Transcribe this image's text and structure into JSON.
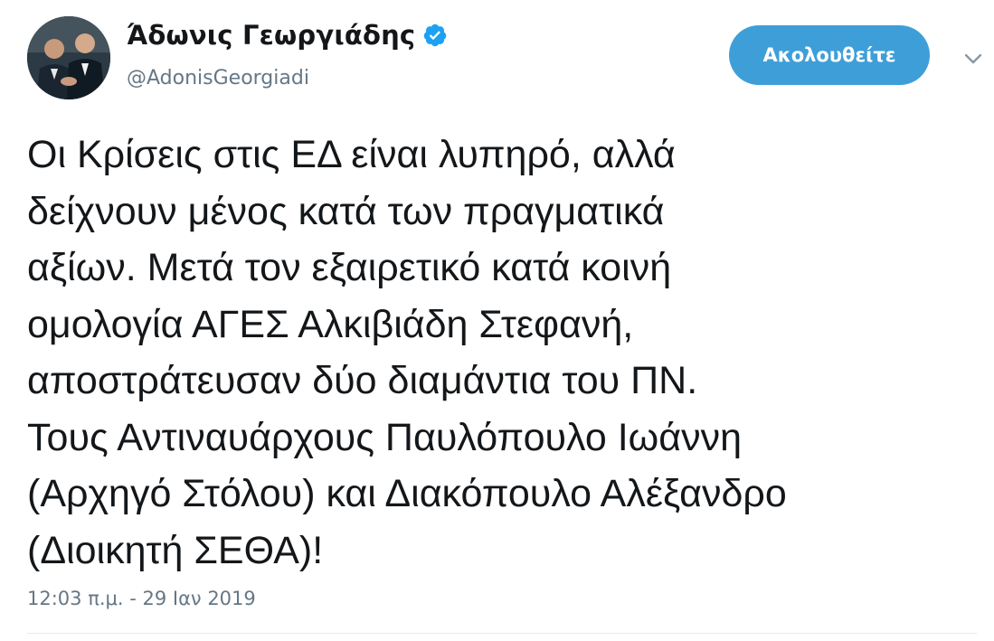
{
  "author": {
    "display_name": "Άδωνις Γεωργιάδης",
    "handle": "@AdonisGeorgiadi",
    "verified": true,
    "avatar_icon": "profile-photo"
  },
  "actions": {
    "follow_label": "Ακολουθείτε",
    "menu_icon": "chevron-down-icon"
  },
  "tweet": {
    "lines": [
      "Οι Κρίσεις στις ΕΔ είναι λυπηρό, αλλά",
      "δείχνουν μένος κατά των πραγματικά",
      "αξίων. Μετά τον εξαιρετικό κατά κοινή",
      "ομολογία ΑΓΕΣ Αλκιβιάδη Στεφανή,",
      "αποστράτευσαν δύο διαμάντια του ΠΝ.",
      "Τους Αντιναυάρχους Παυλόπουλο Ιωάννη",
      "(Αρχηγό Στόλου) και Διακόπουλο Αλέξανδρο",
      "(Διοικητή ΣΕΘΑ)!"
    ],
    "timestamp": "12:03 π.μ. - 29 Ιαν 2019"
  },
  "colors": {
    "accent": "#3e9fd8",
    "verified_badge": "#1da1f2",
    "secondary_text": "#657786",
    "primary_text": "#14171a"
  }
}
